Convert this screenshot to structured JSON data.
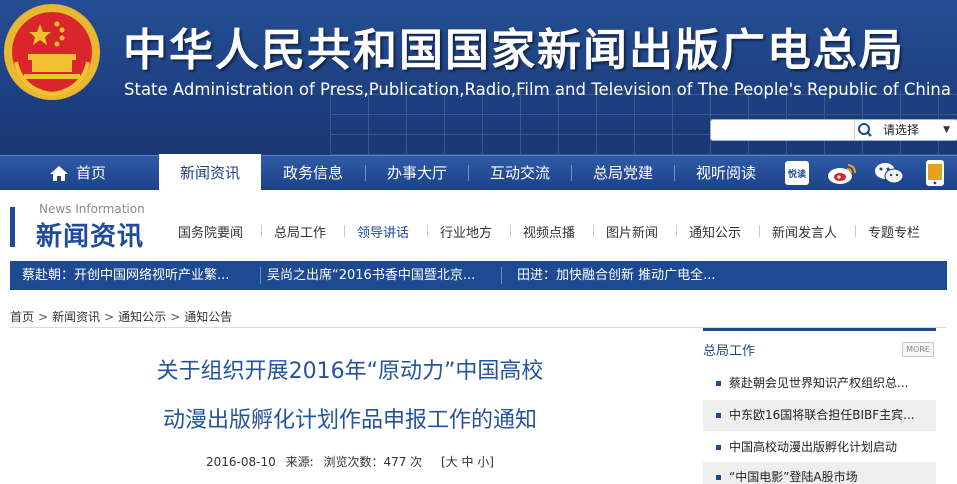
{
  "banner": {
    "title_cn": "中华人民共和国国家新闻出版广电总局",
    "title_en": "State Administration of Press,Publication,Radio,Film and Television of The People's Republic of China"
  },
  "search": {
    "value": "",
    "placeholder": "",
    "scope_label": "请选择"
  },
  "nav": {
    "items": [
      "首页",
      "新闻资讯",
      "政务信息",
      "办事大厅",
      "互动交流",
      "总局党建",
      "视听阅读"
    ],
    "active_index": 1,
    "icon_badges": {
      "read": "悦读"
    }
  },
  "section": {
    "title_en": "News Information",
    "title_cn": "新闻资讯",
    "subnav": [
      "国务院要闻",
      "总局工作",
      "领导讲话",
      "行业地方",
      "视频点播",
      "图片新闻",
      "通知公示",
      "新闻发言人",
      "专题专栏"
    ],
    "current_index": 2
  },
  "ticker": [
    "蔡赴朝：开创中国网络视听产业繁...",
    "吴尚之出席“2016书香中国暨北京...",
    "田进：加快融合创新 推动广电全..."
  ],
  "breadcrumb": {
    "items": [
      "首页",
      "新闻资讯",
      "通知公示",
      "通知公告"
    ],
    "separator": ">"
  },
  "article": {
    "title_line1": "关于组织开展2016年“原动力”中国高校",
    "title_line2": "动漫出版孵化计划作品申报工作的通知",
    "date": "2016-08-10",
    "source_label": "来源:",
    "views_label": "浏览次数：477 次",
    "size_label": "[大 中 小]"
  },
  "sidebar": {
    "heading": "总局工作",
    "more_label": "MORE",
    "items": [
      "蔡赴朝会见世界知识产权组织总...",
      "中东欧16国将联合担任BIBF主宾...",
      "中国高校动漫出版孵化计划启动",
      "“中国电影”登陆A股市场"
    ]
  },
  "colors": {
    "brand_blue": "#1e4a92",
    "title_blue": "#24549c",
    "banner_blue": "#1e4183"
  }
}
